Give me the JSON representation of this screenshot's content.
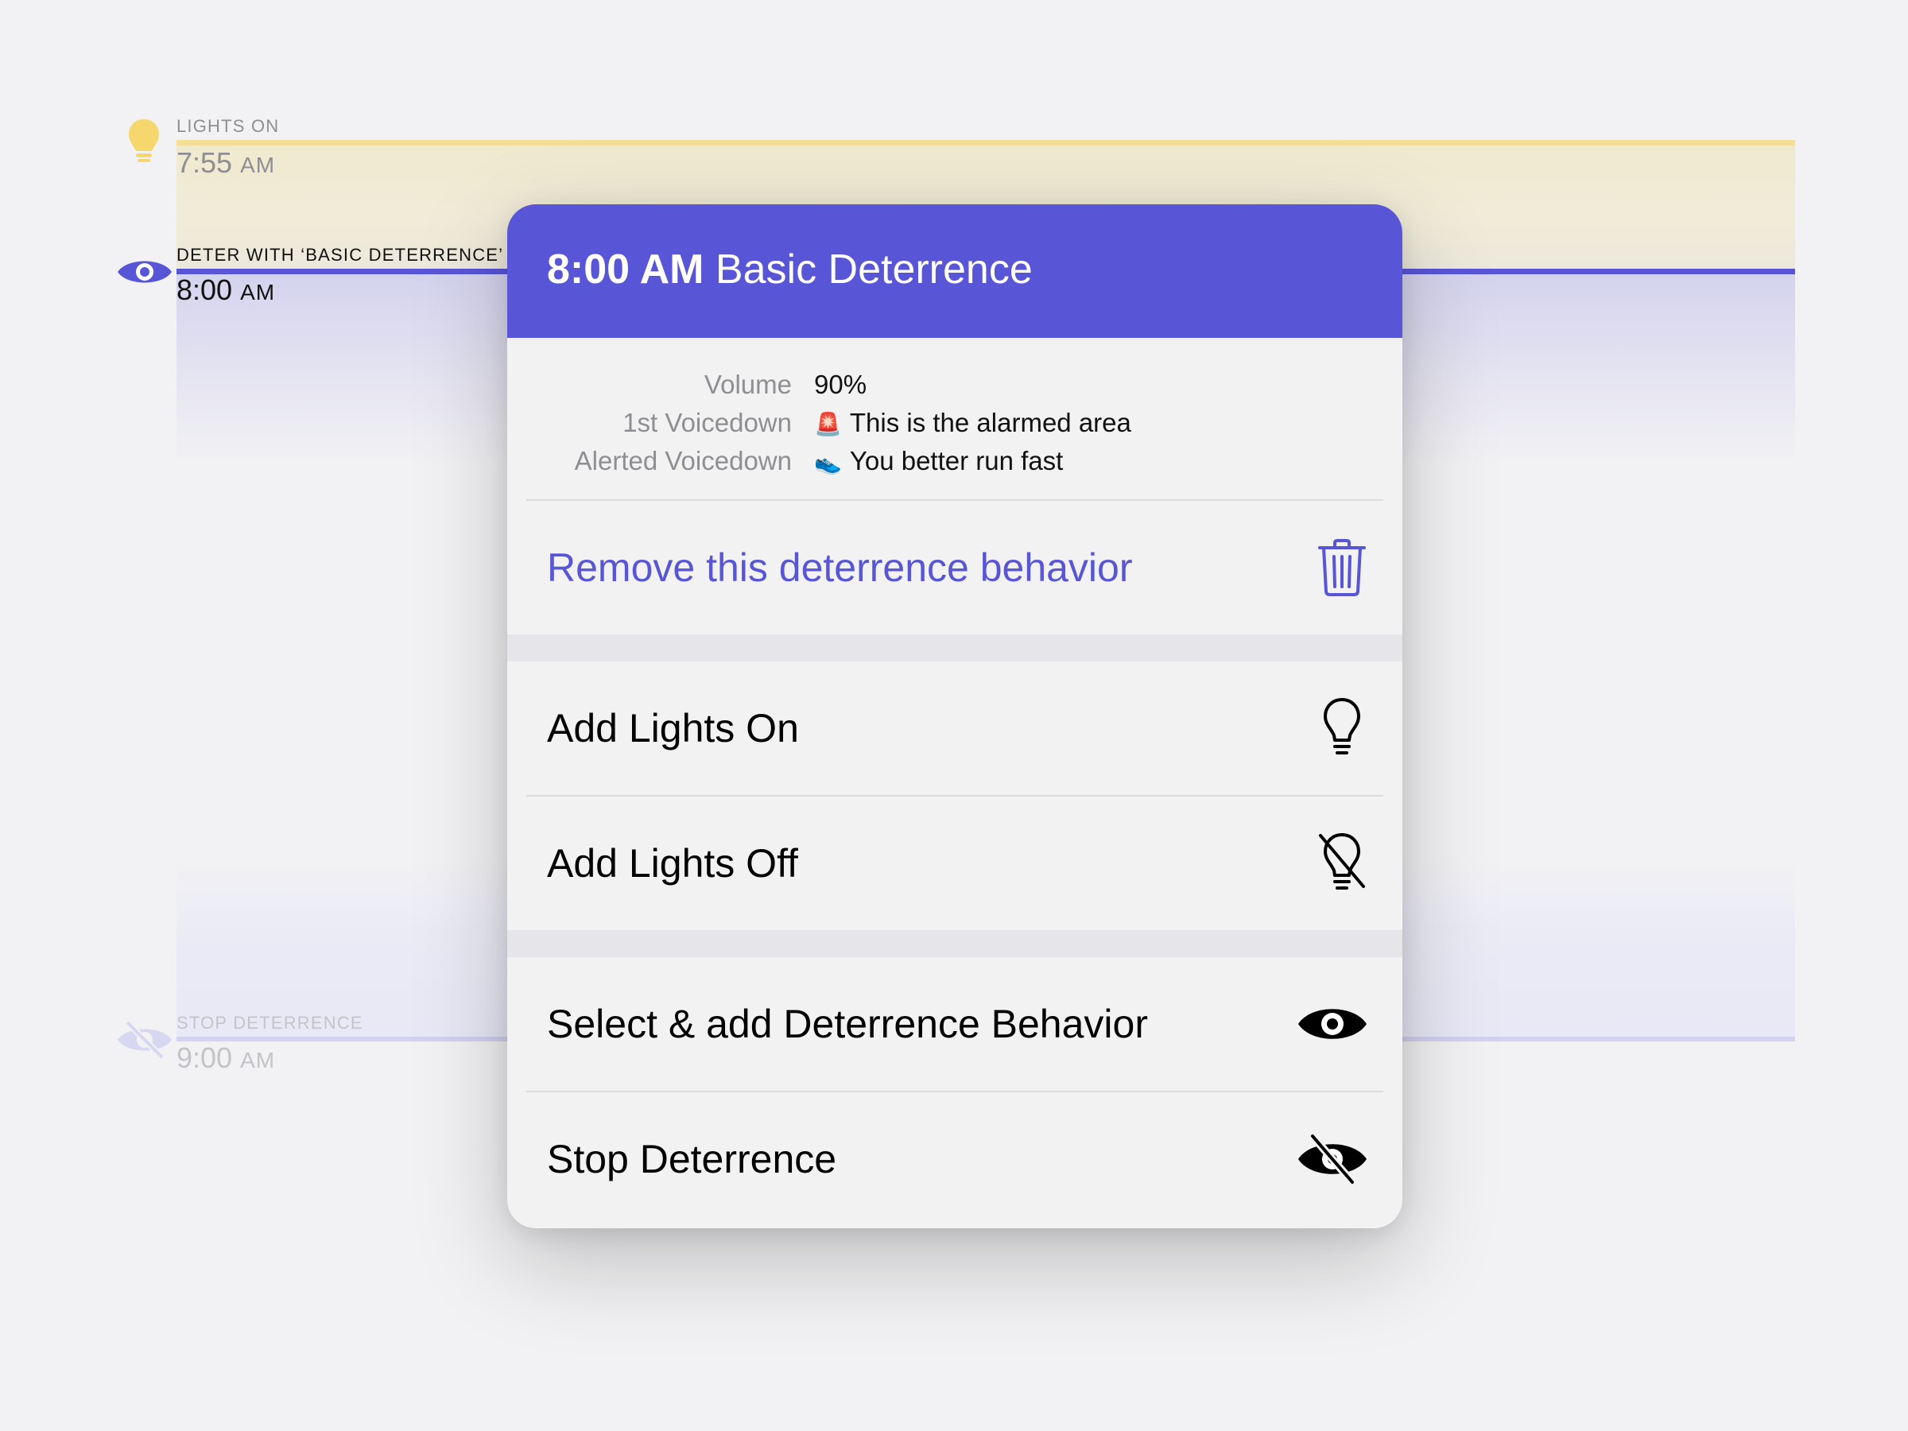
{
  "timeline": {
    "events": [
      {
        "label": "LIGHTS ON",
        "time": "7:55",
        "ampm": "AM"
      },
      {
        "label": "DETER WITH ‘BASIC DETERRENCE’",
        "time": "8:00",
        "ampm": "AM"
      },
      {
        "label": "STOP DETERRENCE",
        "time": "9:00",
        "ampm": "AM"
      }
    ],
    "icons": [
      "lightbulb-icon",
      "eye-icon",
      "eye-slash-icon"
    ]
  },
  "modal": {
    "header": {
      "time": "8:00 AM",
      "title": "Basic Deterrence"
    },
    "details": [
      {
        "key": "Volume",
        "emoji": "",
        "value": "90%"
      },
      {
        "key": "1st Voicedown",
        "emoji": "🚨",
        "value": "This is the alarmed area"
      },
      {
        "key": "Alerted Voicedown",
        "emoji": "👟",
        "value": "You better run fast"
      }
    ],
    "actions": [
      {
        "label": "Remove this deterrence behavior",
        "icon": "trash-icon"
      },
      {
        "label": "Add Lights On",
        "icon": "lightbulb-icon"
      },
      {
        "label": "Add Lights Off",
        "icon": "lightbulb-slash-icon"
      },
      {
        "label": "Select & add Deterrence Behavior",
        "icon": "eye-icon"
      },
      {
        "label": "Stop Deterrence",
        "icon": "eye-slash-icon"
      }
    ]
  },
  "colors": {
    "accent": "#5856d6",
    "lights": "#f5d76e",
    "background": "#f2f2f4"
  }
}
